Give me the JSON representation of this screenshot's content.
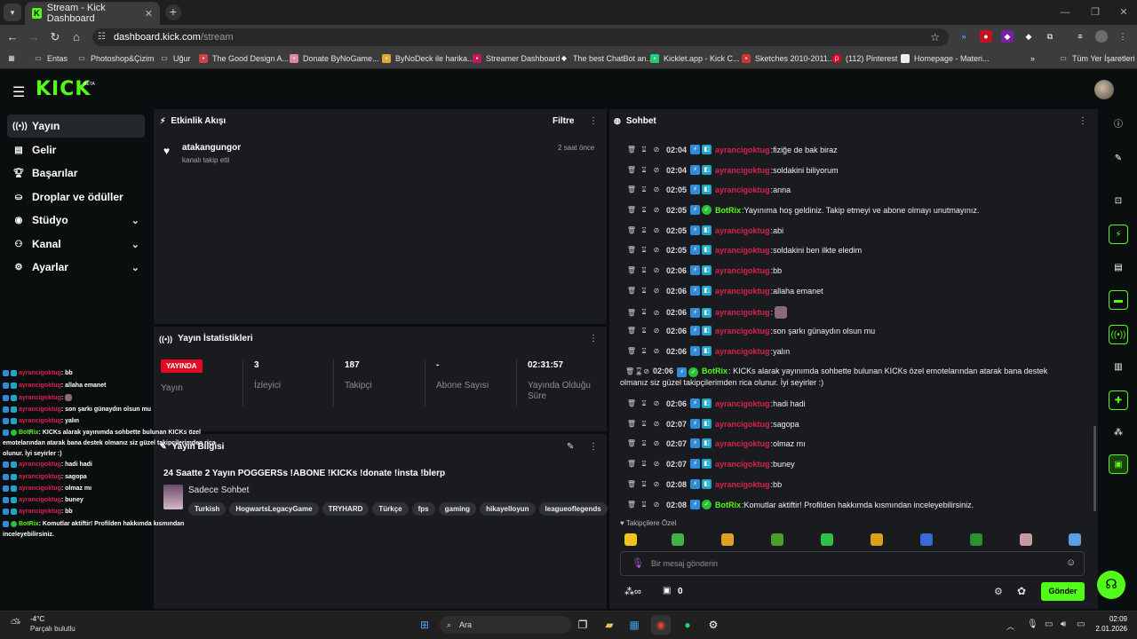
{
  "browser": {
    "tab_title": "Stream - Kick Dashboard",
    "url_host": "dashboard.kick.com",
    "url_path": "/stream",
    "bookmarks": [
      {
        "label": "Entas",
        "icon": "folder-icon"
      },
      {
        "label": "Photoshop&Çizim",
        "icon": "folder-icon"
      },
      {
        "label": "Uğur",
        "icon": "folder-icon"
      },
      {
        "label": "The Good Design A...",
        "icon": "site-icon"
      },
      {
        "label": "Donate ByNoGame...",
        "icon": "site-icon"
      },
      {
        "label": "ByNoDeck ile harika...",
        "icon": "site-icon"
      },
      {
        "label": "Streamer Dashboard",
        "icon": "site-icon"
      },
      {
        "label": "The best ChatBot an...",
        "icon": "site-icon"
      },
      {
        "label": "Kicklet.app - Kick C...",
        "icon": "site-icon"
      },
      {
        "label": "Sketches 2010-2011...",
        "icon": "site-icon"
      },
      {
        "label": "(112) Pinterest",
        "icon": "pinterest-icon"
      },
      {
        "label": "Homepage - Materi...",
        "icon": "site-icon"
      }
    ],
    "all_bookmarks": "Tüm Yer İşaretleri"
  },
  "kick": {
    "logo": "KICK",
    "beta": "BETA"
  },
  "sidebar": {
    "items": [
      {
        "label": "Yayın",
        "icon": "broadcast-icon"
      },
      {
        "label": "Gelir",
        "icon": "revenue-icon"
      },
      {
        "label": "Başarılar",
        "icon": "trophy-icon"
      },
      {
        "label": "Droplar ve ödüller",
        "icon": "gift-icon"
      },
      {
        "label": "Stüdyo",
        "icon": "studio-icon"
      },
      {
        "label": "Kanal",
        "icon": "channel-icon"
      },
      {
        "label": "Ayarlar",
        "icon": "settings-icon"
      }
    ]
  },
  "activity": {
    "title": "Etkinlik Akışı",
    "filter": "Filtre",
    "events": [
      {
        "user": "atakangungor",
        "action": "kanalı takip etti",
        "time": "2 saat önce"
      }
    ]
  },
  "stats": {
    "title": "Yayın İstatistikleri",
    "live_badge": "YAYINDA",
    "live_label": "Yayın",
    "items": [
      {
        "value": "3",
        "label": "İzleyici"
      },
      {
        "value": "187",
        "label": "Takipçi"
      },
      {
        "value": "-",
        "label": "Abone Sayısı"
      },
      {
        "value": "02:31:57",
        "label": "Yayında Olduğu Süre"
      }
    ]
  },
  "info": {
    "title": "Yayın Bilgisi",
    "stream_title": "24 Saatte 2 Yayın POGGERSs !ABONE !KICKs !donate !insta !blerp",
    "category": "Sadece Sohbet",
    "tags": [
      "Turkish",
      "HogwartsLegacyGame",
      "TRYHARD",
      "Türkçe",
      "fps",
      "gaming",
      "hikayelloyun",
      "leagueoflegends"
    ]
  },
  "chat": {
    "title": "Sohbet",
    "messages": [
      {
        "time": "02:04",
        "user": "ayrancigoktug",
        "text": "fiziğe de bak biraz",
        "bot": false
      },
      {
        "time": "02:04",
        "user": "ayrancigoktug",
        "text": "soldakini biliyorum",
        "bot": false
      },
      {
        "time": "02:05",
        "user": "ayrancigoktug",
        "text": "anna",
        "bot": false
      },
      {
        "time": "02:05",
        "user": "BotRix",
        "text": "Yayınıma hoş geldiniz. Takip etmeyi ve abone olmayı unutmayınız.",
        "bot": true
      },
      {
        "time": "02:05",
        "user": "ayrancigoktug",
        "text": "abi",
        "bot": false
      },
      {
        "time": "02:05",
        "user": "ayrancigoktug",
        "text": "soldakini ben ilkte eledim",
        "bot": false
      },
      {
        "time": "02:06",
        "user": "ayrancigoktug",
        "text": "bb",
        "bot": false
      },
      {
        "time": "02:06",
        "user": "ayrancigoktug",
        "text": "allaha emanet",
        "bot": false
      },
      {
        "time": "02:06",
        "user": "ayrancigoktug",
        "text": "",
        "bot": false
      },
      {
        "time": "02:06",
        "user": "ayrancigoktug",
        "text": "son şarkı günaydın olsun mu",
        "bot": false
      },
      {
        "time": "02:06",
        "user": "ayrancigoktug",
        "text": "yalın",
        "bot": false
      },
      {
        "time": "02:06",
        "user": "BotRix",
        "text": "KICKs alarak yayınımda sohbette bulunan KICKs özel emotelarından atarak bana destek olmanız siz güzel takipçilerimden rica olunur. İyi seyirler :)",
        "bot": true
      },
      {
        "time": "02:06",
        "user": "ayrancigoktug",
        "text": "hadi hadi",
        "bot": false
      },
      {
        "time": "02:07",
        "user": "ayrancigoktug",
        "text": "sagopa",
        "bot": false
      },
      {
        "time": "02:07",
        "user": "ayrancigoktug",
        "text": "olmaz mı",
        "bot": false
      },
      {
        "time": "02:07",
        "user": "ayrancigoktug",
        "text": "buney",
        "bot": false
      },
      {
        "time": "02:08",
        "user": "ayrancigoktug",
        "text": "bb",
        "bot": false
      },
      {
        "time": "02:08",
        "user": "BotRix",
        "text": "Komutlar aktiftir! Profilden hakkımda kısmından inceleyebilirsiniz.",
        "bot": true
      }
    ],
    "followers_only": "Takipçilere Özel",
    "input_placeholder": "Bir mesaj gönderin",
    "counter": "0",
    "send": "Gönder"
  },
  "overlay": {
    "lines": [
      {
        "user": "ayrancigoktug",
        "text": ": bb"
      },
      {
        "user": "ayrancigoktug",
        "text": ": allaha emanet"
      },
      {
        "user": "ayrancigoktug",
        "text": ": "
      },
      {
        "user": "ayrancigoktug",
        "text": ": son şarkı günaydın olsun mu"
      },
      {
        "user": "ayrancigoktug",
        "text": ": yalın"
      },
      {
        "user": "BotRix",
        "text": ": KICKs alarak yayınımda sohbette bulunan KICKs özel"
      },
      {
        "user": "",
        "text": "emotelarından atarak bana destek olmanız siz güzel takipçilerimden rica"
      },
      {
        "user": "",
        "text": "olunur. İyi seyirler :)"
      },
      {
        "user": "ayrancigoktug",
        "text": ": hadi hadi"
      },
      {
        "user": "ayrancigoktug",
        "text": ": sagopa"
      },
      {
        "user": "ayrancigoktug",
        "text": ": olmaz mı"
      },
      {
        "user": "ayrancigoktug",
        "text": ": buney"
      },
      {
        "user": "ayrancigoktug",
        "text": ": bb"
      },
      {
        "user": "BotRix",
        "text": ": Komutlar aktiftir! Profilden hakkımda kısmından"
      },
      {
        "user": "",
        "text": "inceleyebilirsiniz."
      }
    ]
  },
  "taskbar": {
    "weather_temp": "-4°C",
    "weather_desc": "Parçalı bulutlu",
    "search_label": "Ara",
    "time": "02:09",
    "date": "2.01.2026"
  },
  "colors": {
    "accent": "#53fc18",
    "username": "#d9214f",
    "live": "#e00b24"
  }
}
